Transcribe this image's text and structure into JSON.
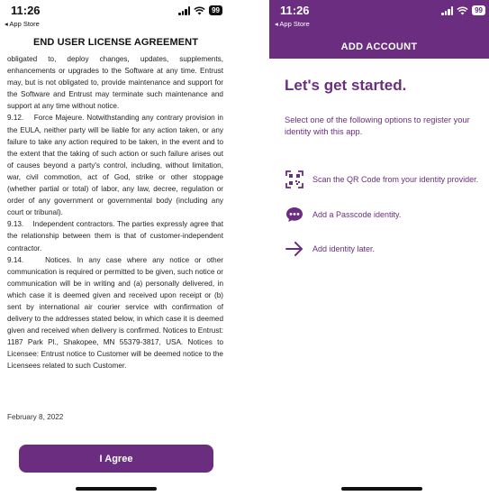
{
  "left": {
    "status": {
      "time": "11:26",
      "back": "◂ App Store",
      "battery": "99"
    },
    "title": "END USER LICENSE AGREEMENT",
    "paragraphs": [
      "obligated to, deploy changes, updates, supplements, enhancements or upgrades to the Software at any time. Entrust may, but is not obligated to, provide maintenance and support for the Software and Entrust may terminate such maintenance and support at any time without notice.",
      "9.12.    Force Majeure. Notwithstanding any contrary provision in the EULA, neither party will be liable for any action taken, or any failure to take any action required to be taken, in the event and to the extent that the taking of such action or such failure arises out of causes beyond a party's control, including, without limitation, war, civil commotion, act of God, strike or other stoppage (whether partial or total) of labor, any law, decree, regulation or order of any government or governmental body (including any court or tribunal).",
      "9.13.    Independent contractors. The parties expressly agree that the relationship between them is that of customer-independent contractor.",
      "9.14.    Notices. In any case where any notice or other communication is required or permitted to be given, such notice or communication will be in writing and (a) personally delivered, in which case it is deemed given and received upon receipt or (b) sent by international air courier service with confirmation of delivery to the addresses stated below, in which case it is deemed given and received when delivery is confirmed. Notices to Entrust: 1187 Park Pl., Shakopee, MN 55379-3817, USA. Notices to Licensee: Entrust notice to Customer will be deemed notice to the Licensees related to such Customer."
    ],
    "date": "February 8, 2022",
    "agree_label": "I Agree"
  },
  "right": {
    "status": {
      "time": "11:26",
      "back": "◂ App Store",
      "battery": "99"
    },
    "title": "ADD ACCOUNT",
    "heading": "Let's get started.",
    "intro": "Select one of the following options to register your identity with this app.",
    "options": [
      {
        "icon": "qr-code-icon",
        "label": "Scan the QR Code from your identity provider."
      },
      {
        "icon": "chat-bubble-icon",
        "label": "Add a Passcode identity."
      },
      {
        "icon": "arrow-right-icon",
        "label": "Add identity later."
      }
    ]
  },
  "colors": {
    "brand_purple": "#6b2d80"
  }
}
